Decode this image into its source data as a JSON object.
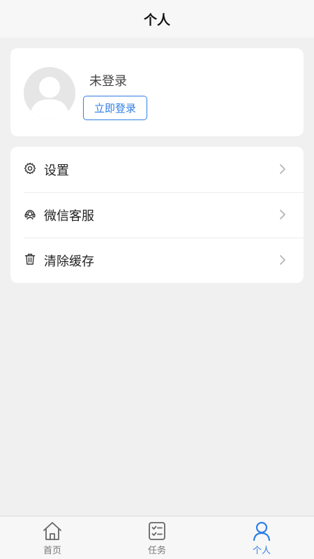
{
  "header": {
    "title": "个人"
  },
  "profile": {
    "status": "未登录",
    "login_label": "立即登录",
    "avatar_icon": "default-avatar-icon"
  },
  "menu": {
    "items": [
      {
        "label": "设置",
        "icon": "gear-icon"
      },
      {
        "label": "微信客服",
        "icon": "headset-icon"
      },
      {
        "label": "清除缓存",
        "icon": "trash-icon"
      }
    ]
  },
  "tabbar": {
    "tabs": [
      {
        "label": "首页",
        "icon": "home-icon",
        "active": false
      },
      {
        "label": "任务",
        "icon": "task-list-icon",
        "active": false
      },
      {
        "label": "个人",
        "icon": "person-icon",
        "active": true
      }
    ]
  },
  "colors": {
    "accent": "#2f7fe6",
    "background": "#f0f0f0",
    "card": "#ffffff"
  }
}
